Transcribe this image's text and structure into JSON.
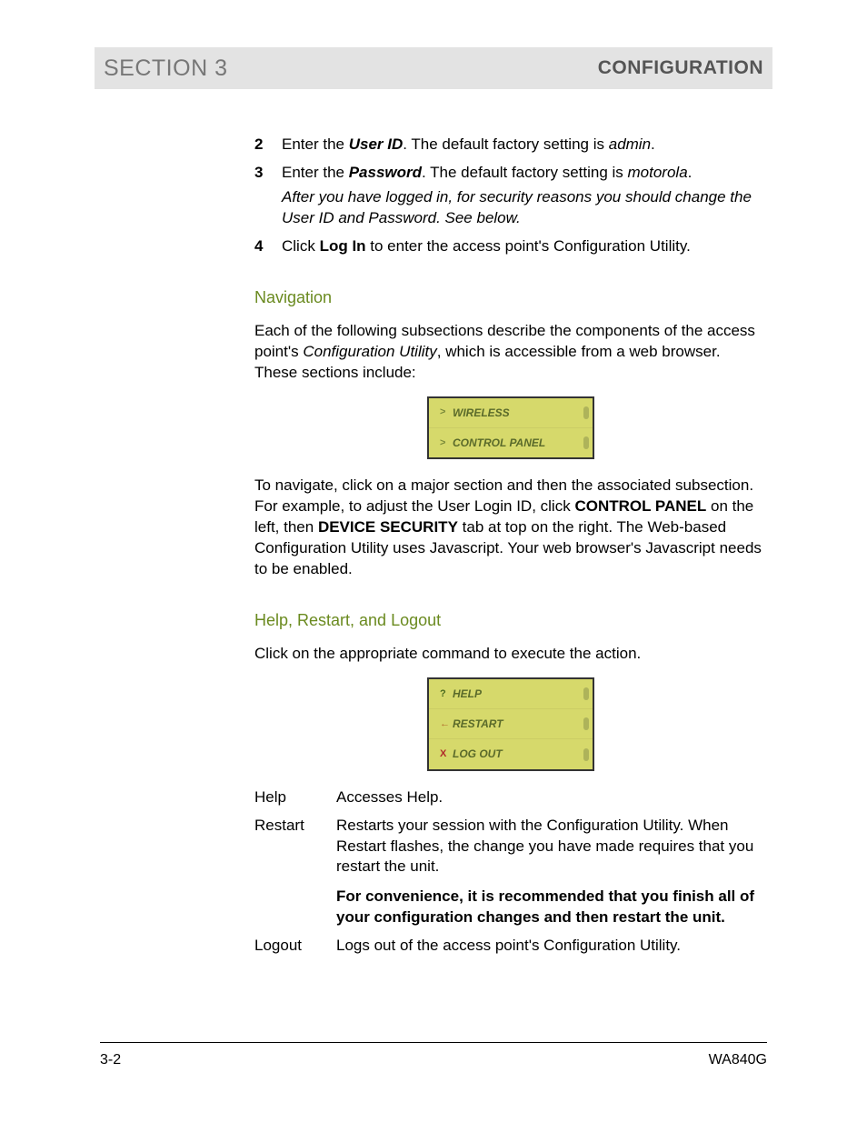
{
  "header": {
    "section": "SECTION 3",
    "title": "CONFIGURATION"
  },
  "steps": [
    {
      "num": "2",
      "prefix": "Enter the ",
      "bolditalic": "User ID",
      "suffix": ". The default factory setting is ",
      "italic_trail": "admin",
      "period": "."
    },
    {
      "num": "3",
      "prefix": "Enter the ",
      "bolditalic": "Password",
      "suffix": ". The default factory setting is ",
      "italic_trail": "motorola",
      "period": ".",
      "note_italic": "After you have logged in, for security reasons you should change the User ID and Password. See below."
    },
    {
      "num": "4",
      "prefix": "Click ",
      "bold": "Log In",
      "suffix": " to enter the access point's Configuration Utility."
    }
  ],
  "nav_heading": "Navigation",
  "nav_para1_a": "Each of the following subsections describe the components of the access point's ",
  "nav_para1_i": "Configuration Utility",
  "nav_para1_b": ", which is accessible from a web browser. These sections include:",
  "nav_menu": [
    {
      "icon": ">",
      "label": "WIRELESS"
    },
    {
      "icon": ">",
      "label": "CONTROL PANEL"
    }
  ],
  "nav_para2_a": "To navigate, click on a major section and then the associated subsection. For example, to adjust the User Login ID, click ",
  "nav_para2_b1": "CONTROL PANEL",
  "nav_para2_mid": " on the left, then ",
  "nav_para2_b2": "DEVICE SECURITY",
  "nav_para2_c": " tab at top on the right. The Web-based Configuration Utility uses Javascript. Your web browser's Javascript needs to be enabled.",
  "help_heading": "Help, Restart, and Logout",
  "help_intro": "Click on the appropriate command to execute the action.",
  "help_menu": [
    {
      "icon": "?",
      "label": "HELP",
      "cls": "green"
    },
    {
      "icon": "←",
      "label": "RESTART",
      "cls": "orange"
    },
    {
      "icon": "X",
      "label": "LOG OUT",
      "cls": "red"
    }
  ],
  "definitions": [
    {
      "term": "Help",
      "def": "Accesses Help."
    },
    {
      "term": "Restart",
      "def": "Restarts your session with the Configuration Utility. When Restart flashes, the change you have made requires that you restart the unit.",
      "bold_note": "For convenience, it is recommended that you finish all of your configuration changes and then restart the unit."
    },
    {
      "term": "Logout",
      "def": "Logs out of the access point's Configuration Utility."
    }
  ],
  "footer": {
    "left": "3-2",
    "right": "WA840G"
  }
}
